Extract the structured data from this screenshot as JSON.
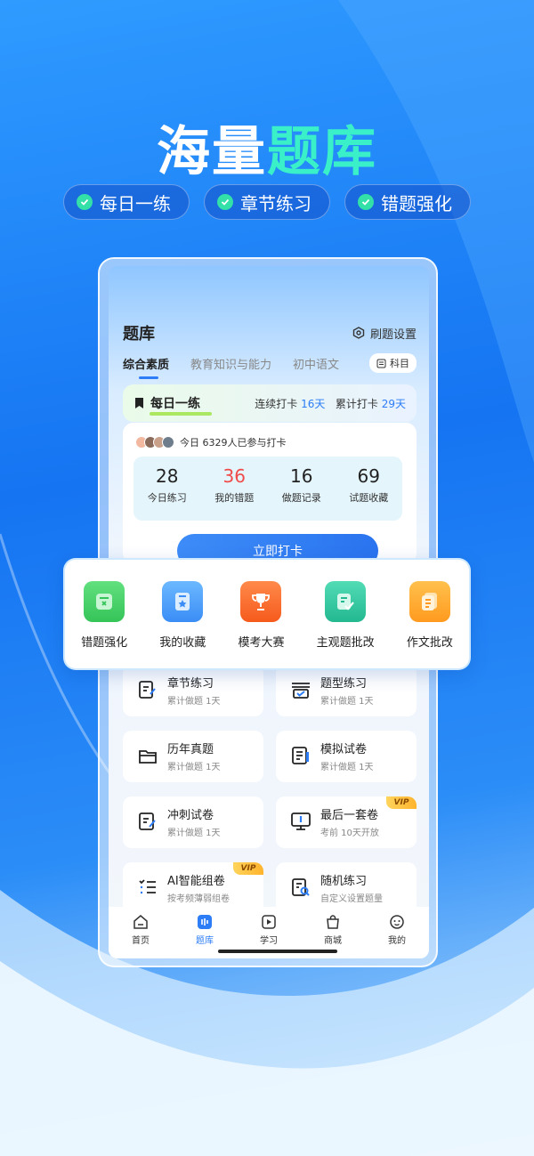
{
  "promo": {
    "headline_part1": "海量",
    "headline_part2": "题库",
    "pills": [
      "每日一练",
      "章节练习",
      "错题强化"
    ]
  },
  "app": {
    "page_title": "题库",
    "settings_label": "刷题设置",
    "tabs": [
      "综合素质",
      "教育知识与能力",
      "初中语文"
    ],
    "subject_button": "科目",
    "daily": {
      "label": "每日一练",
      "streak_label": "连续打卡",
      "streak_value": "16天",
      "total_label": "累计打卡",
      "total_value": "29天",
      "participants": "今日 6329人已参与打卡",
      "stats": [
        {
          "value": "28",
          "label": "今日练习"
        },
        {
          "value": "36",
          "label": "我的错题"
        },
        {
          "value": "16",
          "label": "做题记录"
        },
        {
          "value": "69",
          "label": "试题收藏"
        }
      ],
      "checkin_button": "立即打卡"
    },
    "tools": [
      {
        "label": "错题强化",
        "icon": "wrong-answer-icon",
        "color": "#3fcf63"
      },
      {
        "label": "我的收藏",
        "icon": "favorites-icon",
        "color": "#3f9af7"
      },
      {
        "label": "模考大赛",
        "icon": "trophy-icon",
        "color": "#ff6a2b"
      },
      {
        "label": "主观题批改",
        "icon": "subjective-grading-icon",
        "color": "#2fc7a0"
      },
      {
        "label": "作文批改",
        "icon": "essay-grading-icon",
        "color": "#ffa726"
      }
    ],
    "practice": [
      {
        "title": "章节练习",
        "sub": "累计做题 1天",
        "icon": "chapter-practice-icon"
      },
      {
        "title": "题型练习",
        "sub": "累计做题 1天",
        "icon": "question-type-icon"
      },
      {
        "title": "历年真题",
        "sub": "累计做题 1天",
        "icon": "past-exams-icon"
      },
      {
        "title": "模拟试卷",
        "sub": "累计做题 1天",
        "icon": "mock-exam-icon"
      },
      {
        "title": "冲刺试卷",
        "sub": "累计做题 1天",
        "icon": "sprint-exam-icon"
      },
      {
        "title": "最后一套卷",
        "sub": "考前 10天开放",
        "icon": "final-exam-icon",
        "vip": "VIP"
      },
      {
        "title": "AI智能组卷",
        "sub": "按考频薄弱组卷",
        "icon": "ai-paper-icon",
        "vip": "VIP"
      },
      {
        "title": "随机练习",
        "sub": "自定义设置题量",
        "icon": "random-practice-icon"
      }
    ],
    "tabbar": [
      "首页",
      "题库",
      "学习",
      "商城",
      "我的"
    ],
    "accent": "#2c7df6"
  }
}
